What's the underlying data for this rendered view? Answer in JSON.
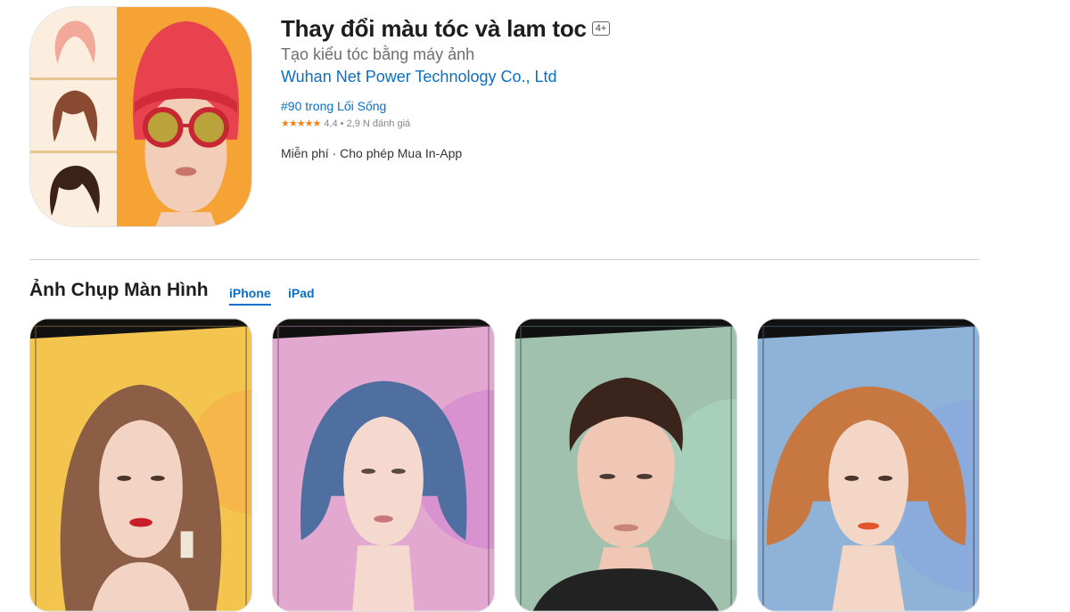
{
  "app": {
    "title": "Thay đổi màu tóc và lam toc",
    "age_rating": "4+",
    "subtitle": "Tạo kiểu tóc bằng máy ảnh",
    "developer": "Wuhan Net Power Technology Co., Ltd",
    "rank": "#90 trong Lối Sống",
    "stars": "★★★★★",
    "rating": "4,4",
    "rating_count": "2,9 N đánh giá",
    "price": "Miễn phí",
    "in_app": "Cho phép Mua In-App"
  },
  "screenshots": {
    "title": "Ảnh Chụp Màn Hình",
    "tabs": [
      "iPhone",
      "iPad"
    ],
    "active_tab": "iPhone",
    "images": [
      {
        "description": "woman-long-brown-hair",
        "bg": "#f3c44e"
      },
      {
        "description": "woman-blue-bob-hair",
        "bg": "#e2a8d0"
      },
      {
        "description": "man-dark-short-hair",
        "bg": "#9fc1ae"
      },
      {
        "description": "woman-auburn-bob-hair",
        "bg": "#8fb3d8"
      }
    ]
  },
  "colors": {
    "link": "#0a6fc7",
    "star": "#f5821f",
    "icon_bg": "#f5a334"
  }
}
